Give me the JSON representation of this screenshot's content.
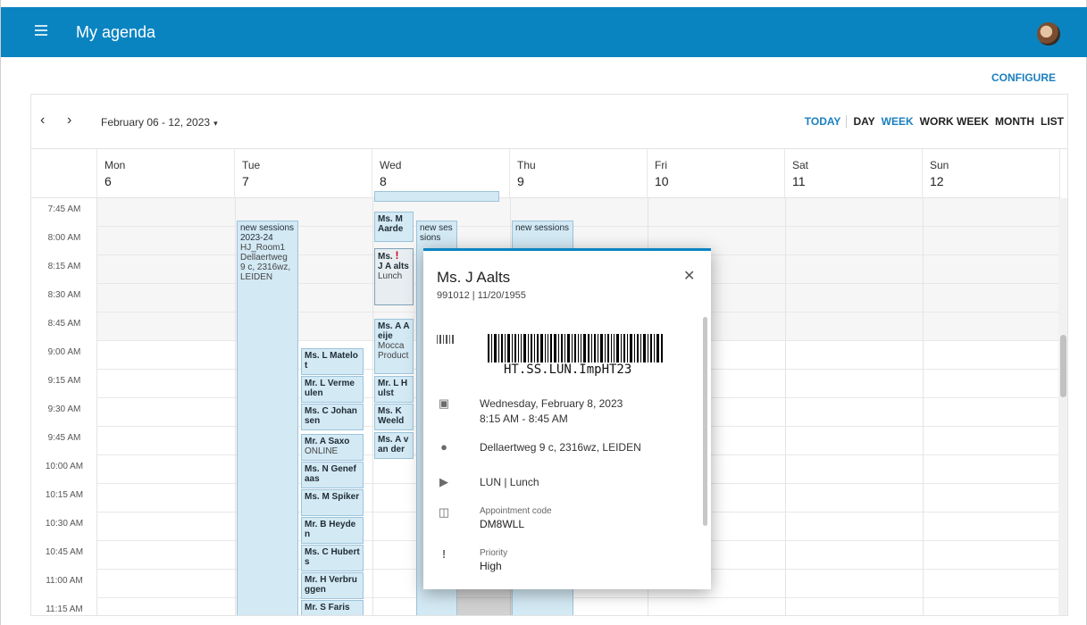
{
  "header": {
    "title": "My agenda",
    "menu_icon": "hamburger-icon",
    "avatar": "user-avatar"
  },
  "configure_label": "CONFIGURE",
  "toolbar": {
    "prev_icon": "chevron-left-icon",
    "next_icon": "chevron-right-icon",
    "prev_glyph": "‹",
    "next_glyph": "›",
    "date_range": "February 06 - 12, 2023",
    "caret": "▾",
    "views": {
      "today": "TODAY",
      "day": "DAY",
      "week": "WEEK",
      "work_week": "WORK WEEK",
      "month": "MONTH",
      "list": "LIST"
    },
    "active_view": "WEEK"
  },
  "days": [
    {
      "name": "Mon",
      "num": "6"
    },
    {
      "name": "Tue",
      "num": "7"
    },
    {
      "name": "Wed",
      "num": "8"
    },
    {
      "name": "Thu",
      "num": "9"
    },
    {
      "name": "Fri",
      "num": "10"
    },
    {
      "name": "Sat",
      "num": "11"
    },
    {
      "name": "Sun",
      "num": "12"
    }
  ],
  "times": [
    "7:45 AM",
    "8:00 AM",
    "8:15 AM",
    "8:30 AM",
    "8:45 AM",
    "9:00 AM",
    "9:15 AM",
    "9:30 AM",
    "9:45 AM",
    "10:00 AM",
    "10:15 AM",
    "10:30 AM",
    "10:45 AM",
    "11:00 AM",
    "11:15 AM"
  ],
  "events": {
    "tue_main": {
      "title": "new sessions 2023-24",
      "room": "HJ_Room1",
      "address": "Dellaertweg 9 c, 2316wz, LEIDEN"
    },
    "tue_list": [
      "Ms. L Matelot",
      "Mr. L Vermeulen",
      "Ms. C Johansen",
      "Mr. A Saxo",
      "Ms. N Genefaas",
      "Ms. M Spiker",
      "Mr. B Heyden",
      "Ms. C Huberts",
      "Mr. H Verbruggen",
      "Mr. S Faris"
    ],
    "tue_saxo_sub": "ONLINE",
    "wed_top": "Ms. M Aarde",
    "wed_selected": {
      "title": "Ms.",
      "title2": "J A alts",
      "sub": "Lunch",
      "bang": "!"
    },
    "wed_aeije": {
      "title": "Ms. A Aeije",
      "sub": "Mocca Product"
    },
    "wed_hulst": "Mr. L Hulst",
    "wed_weeld": "Ms. K Weeld",
    "wed_vander": "Ms. A van der",
    "wed_new": "new sessions",
    "thu_new": "new sessions"
  },
  "popup": {
    "name": "Ms. J Aalts",
    "id_line": "991012 | 11/20/1955",
    "close_icon": "close-icon",
    "close_glyph": "✕",
    "barcode_text": "HT.SS.LUN.ImpHT23",
    "date": "Wednesday, February 8, 2023",
    "time": "8:15 AM - 8:45 AM",
    "location": "Dellaertweg 9 c, 2316wz, LEIDEN",
    "type": "LUN | Lunch",
    "code_label": "Appointment code",
    "code": "DM8WLL",
    "priority_label": "Priority",
    "priority": "High"
  },
  "colors": {
    "header": "#0a84c1",
    "accent": "#1a7fbf",
    "event_bg": "#d3e9f4",
    "event_border": "#9cc4da",
    "priority": "#d0021b"
  }
}
